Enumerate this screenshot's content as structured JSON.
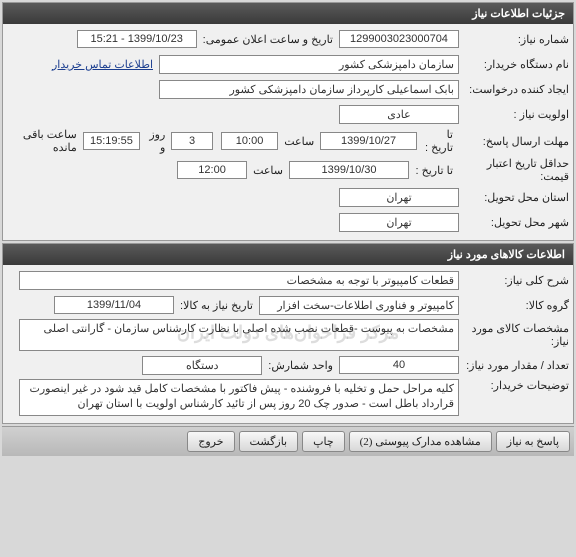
{
  "panel1": {
    "title": "جزئیات اطلاعات نیاز",
    "need_number_label": "شماره نیاز:",
    "need_number": "1299003023000704",
    "announce_label": "تاریخ و ساعت اعلان عمومی:",
    "announce_value": "1399/10/23 - 15:21",
    "buyer_label": "نام دستگاه خریدار:",
    "buyer_value": "سازمان دامپزشکی کشور",
    "contact_link": "اطلاعات تماس خریدار",
    "requester_label": "ایجاد کننده درخواست:",
    "requester_value": "بابک اسماعیلی کارپرداز سازمان دامپزشکی کشور",
    "priority_label": "اولویت نیاز :",
    "priority_value": "عادی",
    "deadline_label": "مهلت ارسال پاسخ:",
    "until_label": "تا تاریخ :",
    "deadline_date": "1399/10/27",
    "time_label": "ساعت",
    "deadline_time": "10:00",
    "days_value": "3",
    "days_label": "روز و",
    "countdown": "15:19:55",
    "remain_label": "ساعت باقی مانده",
    "validity_label": "حداقل تاریخ اعتبار قیمت:",
    "validity_date": "1399/10/30",
    "validity_time": "12:00",
    "province_label": "استان محل تحویل:",
    "province_value": "تهران",
    "city_label": "شهر محل تحویل:",
    "city_value": "تهران"
  },
  "panel2": {
    "title": "اطلاعات کالاهای مورد نیاز",
    "desc_label": "شرح کلی نیاز:",
    "desc_value": "قطعات کامپیوتر با توجه به مشخصات",
    "group_label": "گروه کالا:",
    "group_value": "کامپیوتر و فناوری اطلاعات-سخت افزار",
    "need_date_label": "تاریخ نیاز به کالا:",
    "need_date_value": "1399/11/04",
    "spec_label": "مشخصات کالای مورد نیاز:",
    "spec_value": "مشخصات به پیوست -قطعات نصب شده اصلی با نظارت کارشناس سازمان  -  گارانتی اصلی",
    "qty_label": "تعداد / مقدار مورد نیاز:",
    "qty_value": "40",
    "unit_label": "واحد شمارش:",
    "unit_value": "دستگاه",
    "buyer_notes_label": "توضیحات خریدار:",
    "buyer_notes_value": "کلیه مراحل حمل و تخلیه با فروشنده - پیش فاکتور با مشخصات کامل قید شود در غیر اینصورت قرارداد باطل است - صدور چک 20 روز پس از تائید کارشناس اولویت با استان تهران",
    "watermark": "مرکز فراخوان‌های دولت ایران"
  },
  "buttons": {
    "reply": "پاسخ به نیاز",
    "attachments": "مشاهده مدارک پیوستی (2)",
    "print": "چاپ",
    "back": "بازگشت",
    "exit": "خروج"
  }
}
